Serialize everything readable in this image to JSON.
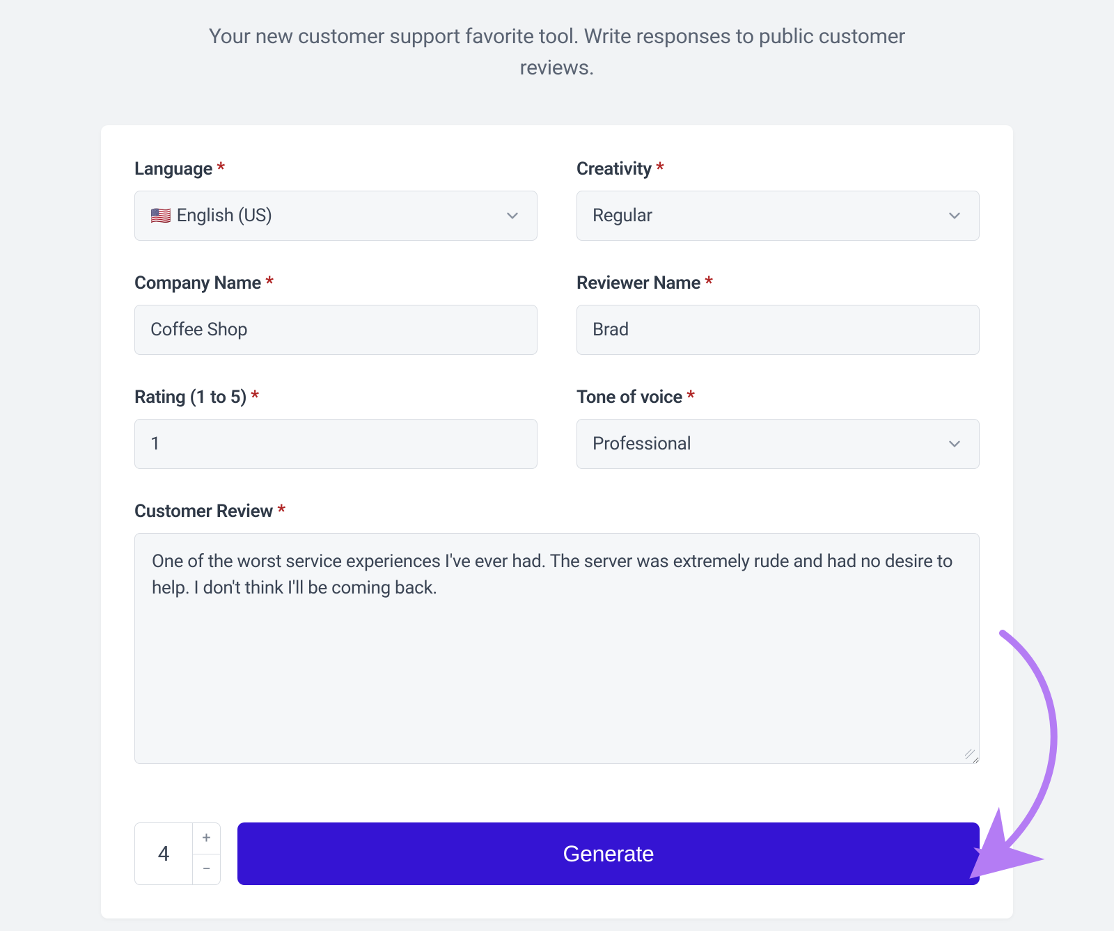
{
  "tagline": "Your new customer support favorite tool. Write responses to public customer reviews.",
  "fields": {
    "language": {
      "label": "Language",
      "value": "English (US)",
      "flag": "🇺🇸"
    },
    "creativity": {
      "label": "Creativity",
      "value": "Regular"
    },
    "company": {
      "label": "Company Name",
      "value": "Coffee Shop"
    },
    "reviewer": {
      "label": "Reviewer Name",
      "value": "Brad"
    },
    "rating": {
      "label": "Rating (1 to 5)",
      "value": "1"
    },
    "tone": {
      "label": "Tone of voice",
      "value": "Professional"
    },
    "review": {
      "label": "Customer Review",
      "value": "One of the worst service experiences I've ever had. The server was extremely rude and had no desire to help. I don't think I'll be coming back."
    }
  },
  "action": {
    "count": "4",
    "plus": "+",
    "minus": "−",
    "generate": "Generate"
  }
}
